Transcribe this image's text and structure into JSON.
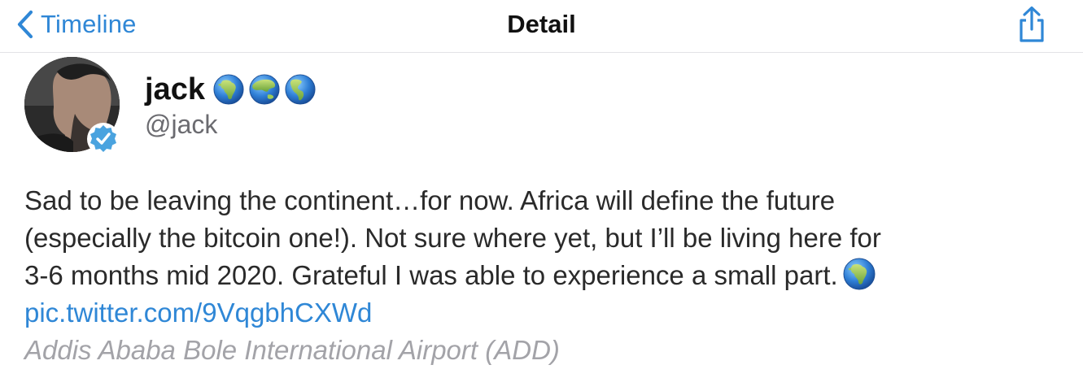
{
  "navbar": {
    "back_label": "Timeline",
    "title": "Detail",
    "share_icon": "share-icon"
  },
  "author": {
    "display_name": "jack",
    "name_emoji": [
      "globe-africa-icon",
      "globe-asia-icon",
      "globe-americas-icon"
    ],
    "handle": "@jack",
    "verified": true
  },
  "tweet": {
    "lines": [
      "Sad to be leaving the continent…for now. Africa will define the future",
      "(especially the bitcoin one!). Not sure where yet, but I’ll be living here for",
      "3-6 months mid 2020. Grateful I was able to experience a small part."
    ],
    "trailing_emoji": "globe-africa-icon",
    "link": "pic.twitter.com/9VqgbhCXWd",
    "location": "Addis Ababa Bole International Airport (ADD)"
  },
  "colors": {
    "accent": "#2f87d6",
    "secondary_text": "#6b6b70",
    "location_text": "#a3a3a8",
    "body_text": "#2a2a2a"
  }
}
